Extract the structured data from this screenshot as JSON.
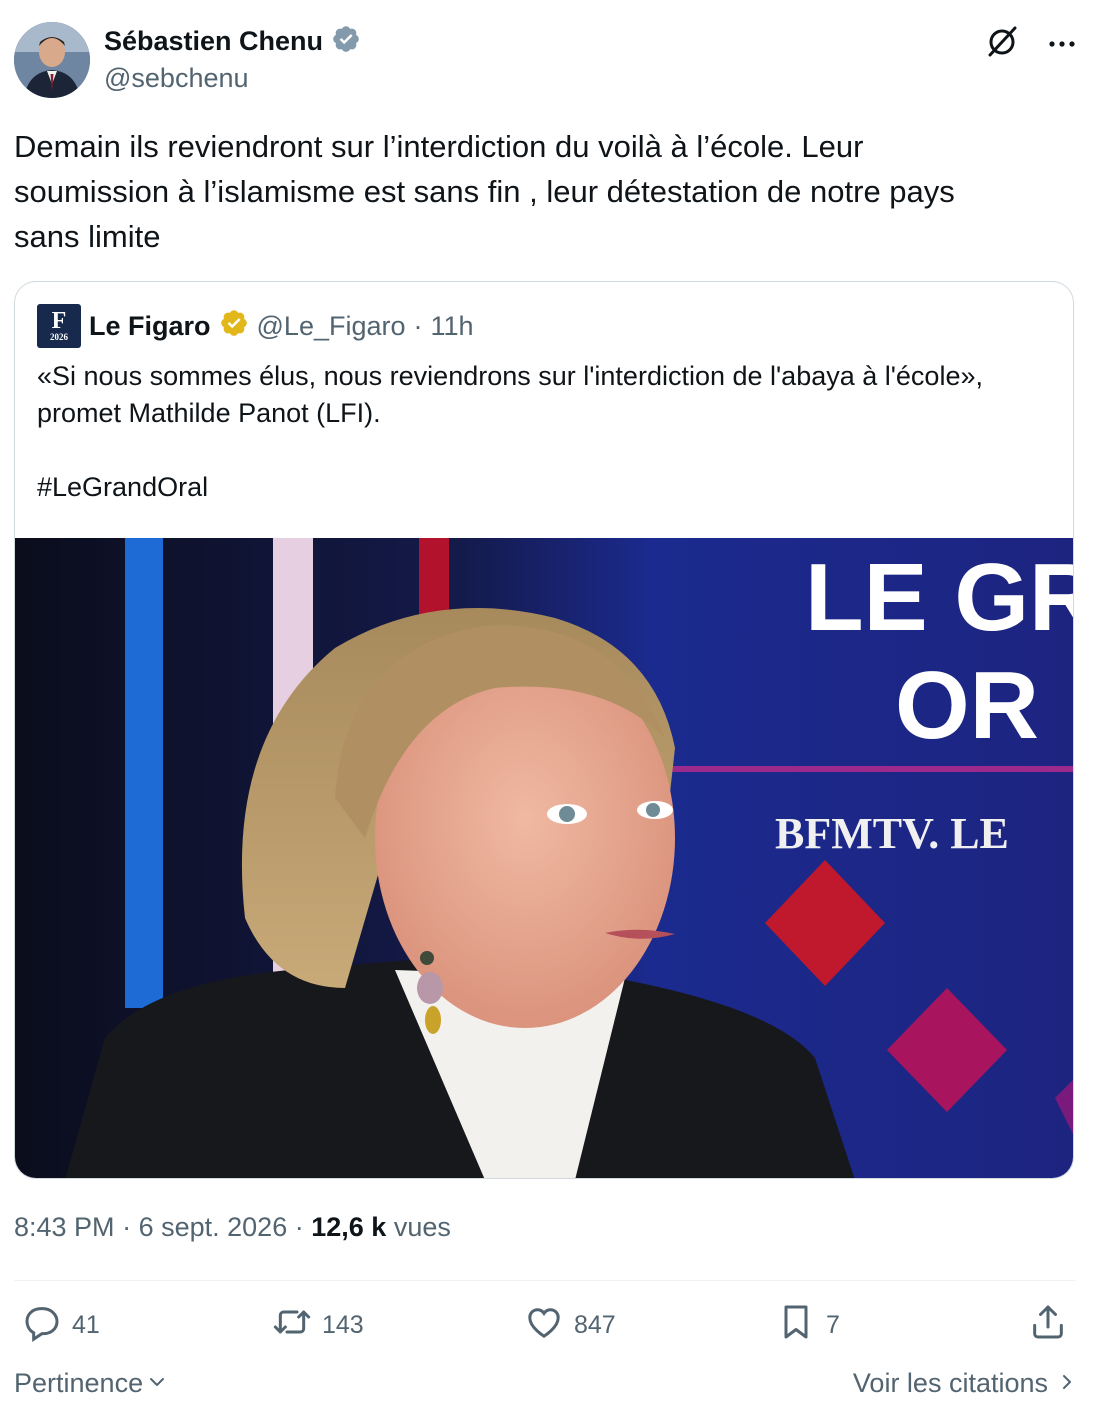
{
  "author": {
    "display_name": "Sébastien Chenu",
    "handle": "@sebchenu",
    "verified_icon": "verified-badge-gray"
  },
  "tweet": {
    "text": "Demain ils reviendront sur l’interdiction du voilà à l’école. Leur\nsoumission à l’islamisme est sans fin , leur détestation de notre pays\nsans limite"
  },
  "quoted": {
    "logo_text": "F",
    "logo_year": "2026",
    "display_name": "Le Figaro",
    "verified_icon": "verified-badge-gold",
    "handle": "@Le_Figaro",
    "separator": "·",
    "time": "11h",
    "text": "«Si nous sommes élus, nous reviendrons sur l'interdiction de l'abaya à l'école»,\npromet Mathilde Panot (LFI).\n\n#LeGrandOral",
    "image_overlay": {
      "line1": "LE GR",
      "line2": "OR",
      "channel": "BFMTV. LE"
    }
  },
  "meta": {
    "time": "8:43 PM",
    "sep1": "·",
    "date": "6 sept. 2026",
    "sep2": "·",
    "views_count": "12,6 k",
    "views_label": "vues"
  },
  "actions": {
    "replies": "41",
    "reposts": "143",
    "likes": "847",
    "bookmarks": "7"
  },
  "footer": {
    "sort_label": "Pertinence",
    "quotes_link": "Voir les citations"
  },
  "colors": {
    "text": "#0f1419",
    "secondary": "#536471",
    "verified_gray": "#829aab",
    "verified_gold": "#e2b719",
    "studio_blue": "#1d2a8c"
  }
}
